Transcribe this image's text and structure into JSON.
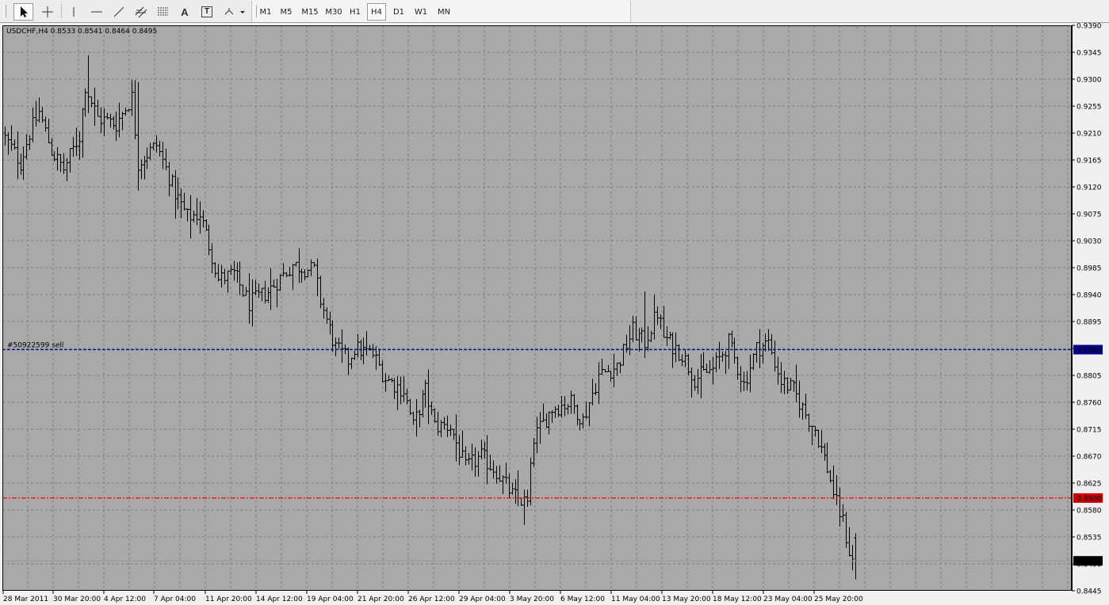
{
  "toolbar": {
    "tools": [
      {
        "name": "cursor-tool",
        "icon": "arrow-cursor-icon"
      },
      {
        "name": "crosshair-tool",
        "icon": "crosshair-icon"
      },
      {
        "name": "vertical-line-tool",
        "icon": "vertical-line-icon"
      },
      {
        "name": "horizontal-line-tool",
        "icon": "horizontal-line-icon"
      },
      {
        "name": "trendline-tool",
        "icon": "trendline-icon"
      },
      {
        "name": "equidistant-channel-tool",
        "icon": "channel-icon"
      },
      {
        "name": "fibonacci-tool",
        "icon": "fibonacci-icon"
      },
      {
        "name": "text-tool",
        "icon": "text-icon",
        "label": "A"
      },
      {
        "name": "text-label-tool",
        "icon": "text-label-icon",
        "label": "T"
      },
      {
        "name": "arrows-tool",
        "icon": "arrows-dropdown-icon"
      }
    ],
    "timeframes": [
      "M1",
      "M5",
      "M15",
      "M30",
      "H1",
      "H4",
      "D1",
      "W1",
      "MN"
    ],
    "active_timeframe": "H4"
  },
  "chart": {
    "header": "USDCHF,H4  0.8533 0.8541 0.8464 0.8495",
    "order_label": "#50922599 sell",
    "sell_price_label": "0.8848",
    "stop_price_label": "0.8600",
    "current_price_label": "0.8495",
    "colors": {
      "background": "#a9a9a9",
      "grid": "#6f7f8f",
      "bars": "#000000",
      "sell_line": "#00008b",
      "stop_line": "#ff0000",
      "current_line": "#8a9aa9"
    }
  },
  "chart_data": {
    "type": "ohlc",
    "symbol": "USDCHF",
    "timeframe": "H4",
    "y_ticks": [
      "0.9390",
      "0.9345",
      "0.9300",
      "0.9255",
      "0.9210",
      "0.9165",
      "0.9120",
      "0.9075",
      "0.9030",
      "0.8985",
      "0.8940",
      "0.8895",
      "0.8850",
      "0.8805",
      "0.8760",
      "0.8715",
      "0.8670",
      "0.8625",
      "0.8580",
      "0.8535",
      "0.8490",
      "0.8445"
    ],
    "x_ticks": [
      "28 Mar 2011",
      "30 Mar 20:00",
      "4 Apr 12:00",
      "7 Apr 04:00",
      "11 Apr 20:00",
      "14 Apr 12:00",
      "19 Apr 04:00",
      "21 Apr 20:00",
      "26 Apr 12:00",
      "29 Apr 04:00",
      "3 May 20:00",
      "6 May 12:00",
      "11 May 04:00",
      "13 May 20:00",
      "18 May 12:00",
      "23 May 04:00",
      "25 May 20:00"
    ],
    "ylim": [
      0.8445,
      0.939
    ],
    "horizontal_lines": [
      {
        "price": 0.8848,
        "label": "0.8848",
        "style": "dashed-blue"
      },
      {
        "price": 0.86,
        "label": "0.8600",
        "style": "dash-dot-red"
      },
      {
        "price": 0.8495,
        "label": "0.8495",
        "style": "current-price"
      }
    ],
    "last_bar": {
      "open": 0.8533,
      "high": 0.8541,
      "low": 0.8464,
      "close": 0.8495
    },
    "anchor_path": [
      [
        0,
        0.921
      ],
      [
        6,
        0.916
      ],
      [
        9,
        0.921
      ],
      [
        12,
        0.9245
      ],
      [
        16,
        0.918
      ],
      [
        20,
        0.915
      ],
      [
        25,
        0.9205
      ],
      [
        27,
        0.929
      ],
      [
        31,
        0.9235
      ],
      [
        37,
        0.9225
      ],
      [
        42,
        0.927
      ],
      [
        44,
        0.916
      ],
      [
        50,
        0.919
      ],
      [
        56,
        0.911
      ],
      [
        60,
        0.907
      ],
      [
        64,
        0.9075
      ],
      [
        68,
        0.9005
      ],
      [
        70,
        0.8965
      ],
      [
        75,
        0.8975
      ],
      [
        80,
        0.8925
      ],
      [
        86,
        0.8945
      ],
      [
        94,
        0.899
      ],
      [
        101,
        0.898
      ],
      [
        103,
        0.893
      ],
      [
        108,
        0.885
      ],
      [
        112,
        0.883
      ],
      [
        114,
        0.885
      ],
      [
        120,
        0.884
      ],
      [
        124,
        0.88
      ],
      [
        130,
        0.878
      ],
      [
        133,
        0.872
      ],
      [
        137,
        0.878
      ],
      [
        140,
        0.872
      ],
      [
        145,
        0.872
      ],
      [
        150,
        0.865
      ],
      [
        155,
        0.867
      ],
      [
        160,
        0.8645
      ],
      [
        165,
        0.8605
      ],
      [
        170,
        0.859
      ],
      [
        172,
        0.87
      ],
      [
        178,
        0.875
      ],
      [
        184,
        0.876
      ],
      [
        188,
        0.873
      ],
      [
        193,
        0.8805
      ],
      [
        199,
        0.882
      ],
      [
        204,
        0.888
      ],
      [
        208,
        0.886
      ],
      [
        212,
        0.891
      ],
      [
        214,
        0.887
      ],
      [
        220,
        0.884
      ],
      [
        224,
        0.88
      ],
      [
        230,
        0.8815
      ],
      [
        235,
        0.886
      ],
      [
        240,
        0.879
      ],
      [
        244,
        0.885
      ],
      [
        248,
        0.886
      ],
      [
        252,
        0.8795
      ],
      [
        256,
        0.878
      ],
      [
        260,
        0.874
      ],
      [
        263,
        0.8715
      ],
      [
        267,
        0.865
      ],
      [
        270,
        0.859
      ],
      [
        272,
        0.856
      ],
      [
        274,
        0.851
      ],
      [
        275,
        0.8495
      ]
    ]
  }
}
